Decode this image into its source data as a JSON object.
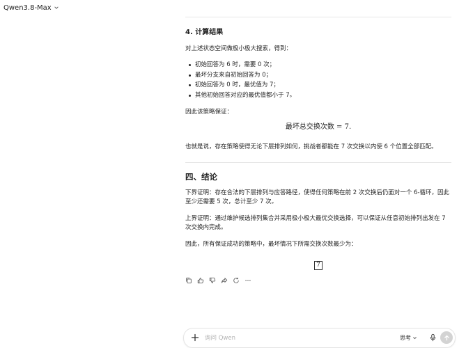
{
  "header": {
    "model_name": "Qwen3.8-Max"
  },
  "section4": {
    "title": "4. 计算结果",
    "intro": "对上述状态空间做极小极大搜索，得到：",
    "bullets": [
      "初始回答为 6 时，需要 0 次；",
      "最坏分支来自初始回答为 0；",
      "初始回答为 0 时，最优值为 7；",
      "其他初始回答对应的最优值都小于 7。"
    ],
    "lead": "因此该策略保证：",
    "equation": "最坏总交换次数 = 7.",
    "after": "也就是说，存在策略使得无论下层排列如何，挑战者都能在 7 次交换以内使 6 个位置全部匹配。"
  },
  "conclusion": {
    "title": "四、结论",
    "p1": "下界证明：存在合法的下层排列与应答路径，使得任何策略在前 2 次交换后仍面对一个 6-循环，因此至少还需要 5 次，总计至少 7 次。",
    "p2": "上界证明：通过维护候选排列集合并采用极小极大最优交换选择，可以保证从任意初始排列出发在 7 次交换内完成。",
    "p3": "因此，所有保证成功的策略中，最坏情况下所需交换次数最少为：",
    "answer": "7"
  },
  "actions": [
    "copy-icon",
    "thumbs-up-icon",
    "thumbs-down-icon",
    "share-icon",
    "regenerate-icon",
    "more-icon"
  ],
  "input_bar": {
    "placeholder": "询问 Qwen",
    "think_label": "思考",
    "send_color": "#d3d3d3"
  }
}
